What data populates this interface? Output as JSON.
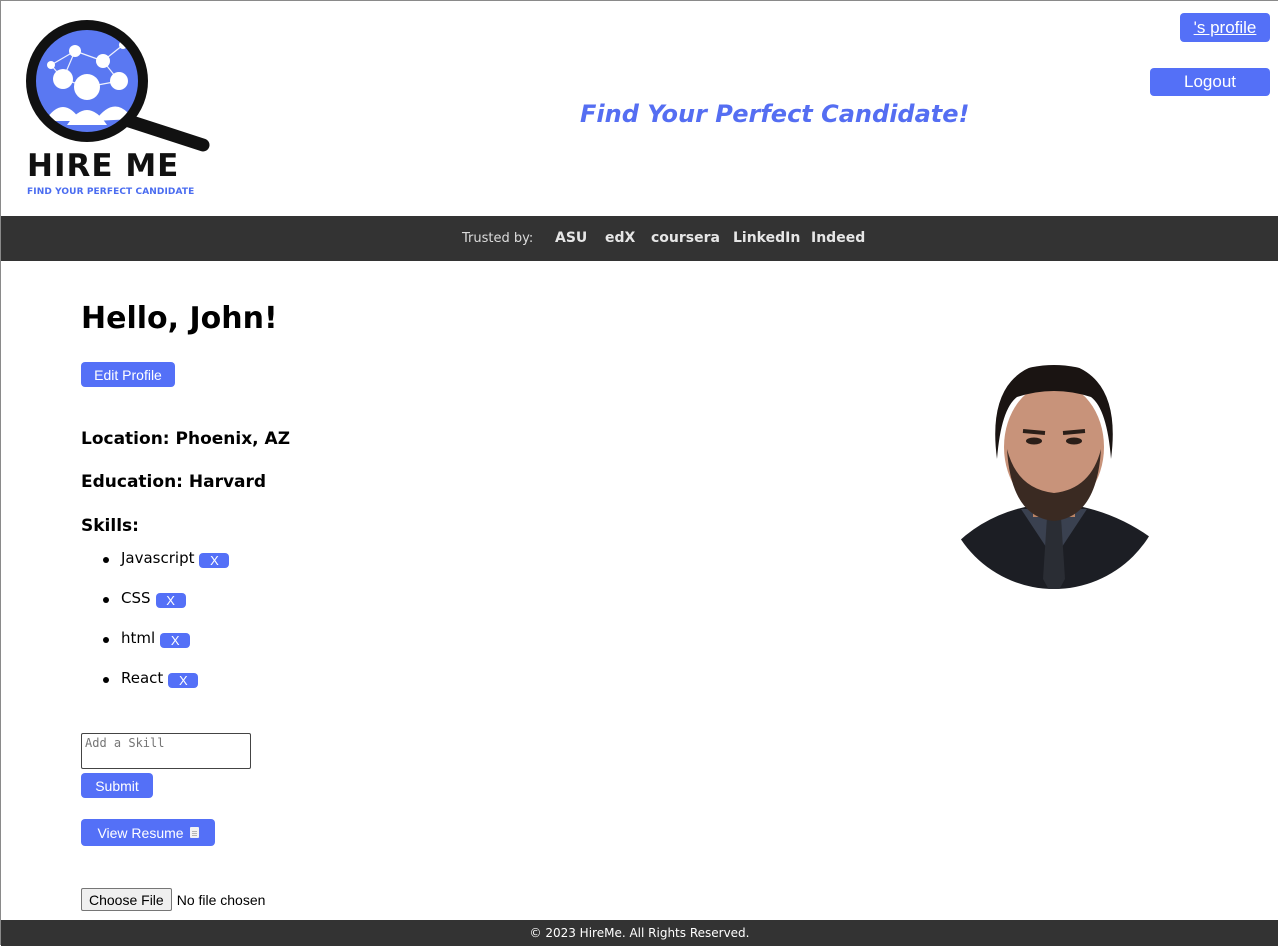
{
  "header": {
    "logo": {
      "title": "HIRE ME",
      "subtitle": "FIND YOUR PERFECT CANDIDATE"
    },
    "tagline": "Find Your Perfect Candidate!",
    "profile_link": "'s profile",
    "logout_label": "Logout"
  },
  "trust_bar": {
    "label": "Trusted by:",
    "brands": [
      "ASU",
      "edX",
      "coursera",
      "LinkedIn",
      "Indeed"
    ]
  },
  "profile": {
    "greeting": "Hello, John!",
    "edit_label": "Edit Profile",
    "location": "Location: Phoenix, AZ",
    "education": "Education: Harvard",
    "skills_heading": "Skills:",
    "skills": [
      {
        "name": "Javascript",
        "remove_label": "X"
      },
      {
        "name": "CSS",
        "remove_label": "X"
      },
      {
        "name": "html",
        "remove_label": "X"
      },
      {
        "name": "React",
        "remove_label": "X"
      }
    ]
  },
  "skill_form": {
    "placeholder": "Add a Skill",
    "submit_label": "Submit"
  },
  "resume": {
    "view_label": "View Resume",
    "icon": "document-icon",
    "choose_file_label": "Choose File",
    "file_status": "No file chosen"
  },
  "footer": {
    "text": "© 2023 HireMe. All Rights Reserved."
  },
  "colors": {
    "accent": "#5470f7",
    "dark_bar": "#333333",
    "tagline": "#556ef2"
  }
}
